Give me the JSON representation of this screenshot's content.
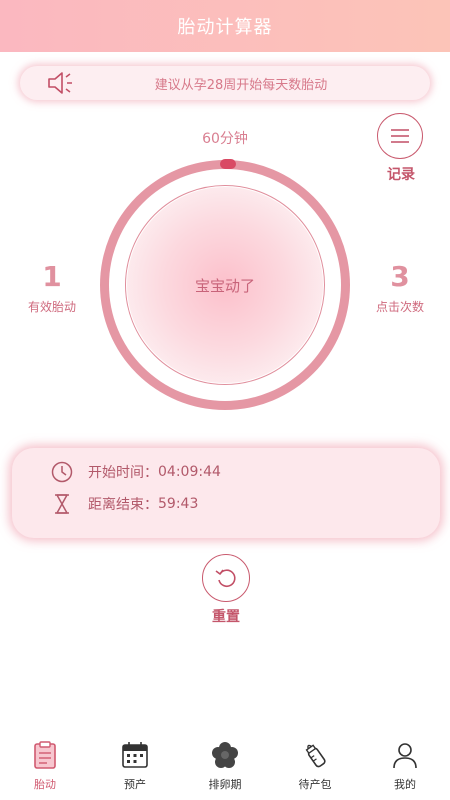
{
  "header": {
    "title": "胎动计算器"
  },
  "tip": {
    "text": "建议从孕28周开始每天数胎动",
    "icon": "speaker-icon"
  },
  "session": {
    "duration_label": "60分钟",
    "progress": 0.0
  },
  "record": {
    "label": "记录",
    "icon": "list-icon"
  },
  "dial": {
    "button_text": "宝宝动了"
  },
  "stats": {
    "effective": {
      "value": "1",
      "label": "有效胎动"
    },
    "clicks": {
      "value": "3",
      "label": "点击次数"
    }
  },
  "timer": {
    "start_label": "开始时间：",
    "start_value": "04:09:44",
    "remaining_label": "距离结束：",
    "remaining_value": "59:43"
  },
  "reset": {
    "label": "重置",
    "icon": "refresh-icon"
  },
  "tabs": [
    {
      "label": "胎动",
      "icon": "clipboard-icon",
      "active": true
    },
    {
      "label": "预产",
      "icon": "calendar-icon",
      "active": false
    },
    {
      "label": "排卵期",
      "icon": "flower-icon",
      "active": false
    },
    {
      "label": "待产包",
      "icon": "baby-bottle-icon",
      "active": false
    },
    {
      "label": "我的",
      "icon": "user-icon",
      "active": false
    }
  ],
  "colors": {
    "accent": "#d05a70",
    "header_start": "#fbb8c0",
    "header_end": "#fcc4b8"
  }
}
